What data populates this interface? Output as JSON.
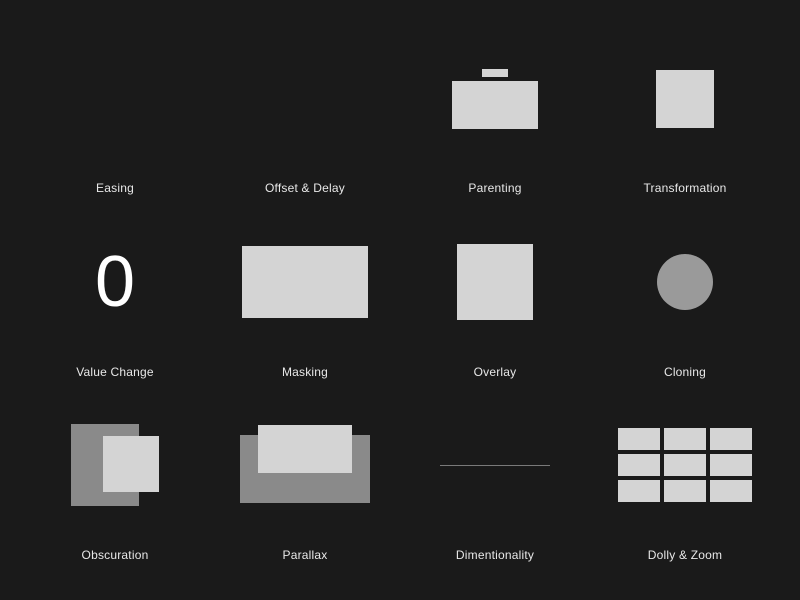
{
  "principles": [
    {
      "id": "easing",
      "label": "Easing"
    },
    {
      "id": "offset-delay",
      "label": "Offset & Delay"
    },
    {
      "id": "parenting",
      "label": "Parenting"
    },
    {
      "id": "transformation",
      "label": "Transformation"
    },
    {
      "id": "value-change",
      "label": "Value Change",
      "value": "0"
    },
    {
      "id": "masking",
      "label": "Masking"
    },
    {
      "id": "overlay",
      "label": "Overlay"
    },
    {
      "id": "cloning",
      "label": "Cloning"
    },
    {
      "id": "obscuration",
      "label": "Obscuration"
    },
    {
      "id": "parallax",
      "label": "Parallax"
    },
    {
      "id": "dimensionality",
      "label": "Dimentionality"
    },
    {
      "id": "dolly-zoom",
      "label": "Dolly & Zoom"
    }
  ],
  "colors": {
    "background": "#1a1a1a",
    "shape_light": "#d4d4d4",
    "shape_dark": "#8a8a8a",
    "text": "#e8e8e8"
  }
}
